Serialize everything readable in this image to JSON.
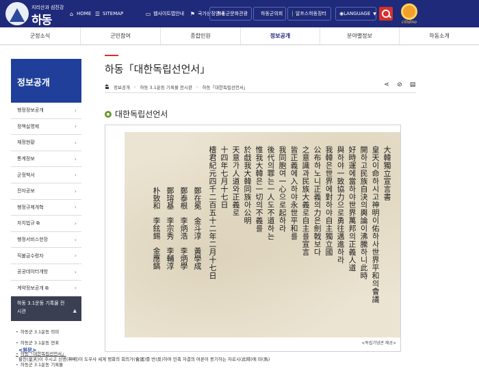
{
  "header": {
    "logo_small": "지리산과 섬진강",
    "logo_text": "하동",
    "util": {
      "home": "HOME",
      "sitemap": "SITEMAP",
      "web_view": "웹사이트맵안내",
      "national": "국가상징안내"
    },
    "pills": [
      "하동군문화관광",
      "하동군의회",
      "알프스하동장터"
    ],
    "language": "LANGUAGE",
    "mascot_text": "citidino"
  },
  "gnb": [
    "군정소식",
    "군민참여",
    "종합민원",
    "정보공개",
    "분야별정보",
    "하동소개"
  ],
  "sidebar": {
    "title": "정보공개",
    "items": [
      "행정정보공개",
      "정책실명제",
      "재정현황",
      "통계정보",
      "군정백서",
      "전자공보",
      "행정규제개혁",
      "자치법규",
      "행정서비스헌장",
      "직불금수령자",
      "공공데이터개방",
      "계약정보공개"
    ],
    "active_line1": "하동 3.1운동 기록물 전",
    "active_line2": "시관",
    "sub": [
      "하동군 3.1운동 의미",
      "하동군 3.1운동 연표",
      "하동「대한독립선언서」",
      "하동군 3.1운동 기록물"
    ]
  },
  "page": {
    "title": "하동「대한독립선언서」",
    "breadcrumb": [
      "정보공개",
      "하동 3.1운동 기록물 전시관",
      "하동「대한독립선언서」"
    ],
    "section_title": "대한독립선언서",
    "credit": "<독립기념관 제공>",
    "original_label": "<원문>",
    "original_text": "황천(皇天)이 주시고 신명(神明)이 도우사 세계 평화의 회의가(會議)를 반(反)하여 민족 자결의 여론이 봉기하는 자로시(此時)에 마(馬)"
  },
  "document": {
    "columns": [
      "大韓獨立宣言書",
      "皇天이命하시고神明이佑하사世界平和의會議",
      "開하고民族自決의輿論이沸騰하니此時",
      "好時運에當하야世界萬邦의正義人道",
      "與하야一致協力으로勇往邁進하라",
      "我韓은世界에對하야自主獨立國",
      "公布하노니正義의力은劍戟보다",
      "之意識과民族大義로自主를宣言",
      "皆正義에入하야永世平和를",
      "我同胞여一心으로起하라",
      "後代의罪는一人도不道하는",
      "惟我大韓은一切의不義를",
      "於戱我大韓同族아公明",
      "天意가人道와正義로",
      "十四年七月十七日",
      "檀君紀元四千二百五十二年二月十七日"
    ],
    "signatures": [
      [
        "鄭在冕",
        "金斗淳",
        "黃學成"
      ],
      [
        "鄭泰根",
        "李炳浩",
        "李炳學"
      ],
      [
        "鄭瑢基",
        "李宗秀",
        "李輔淳"
      ],
      [
        "朴致和",
        "李鉉錫",
        "金應鎬"
      ]
    ]
  }
}
